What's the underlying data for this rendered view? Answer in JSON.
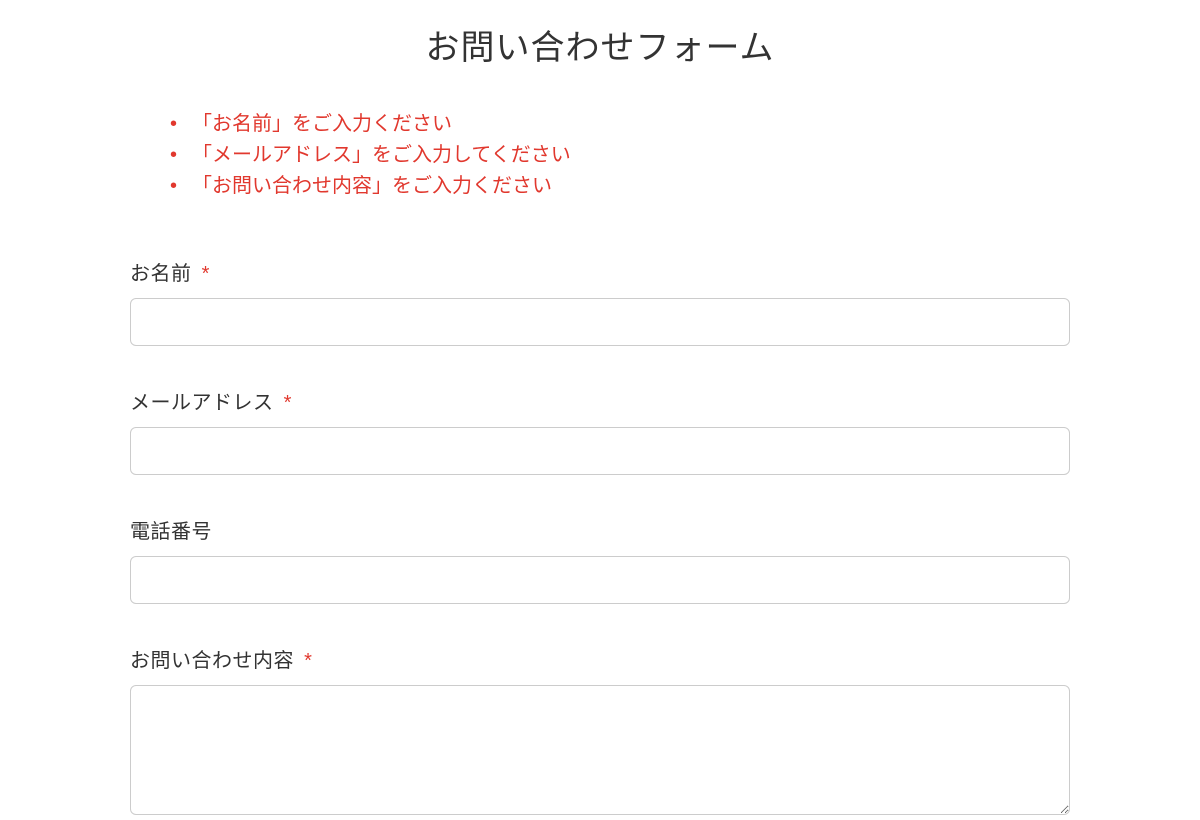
{
  "form": {
    "title": "お問い合わせフォーム",
    "required_mark": "*",
    "errors": [
      "「お名前」をご入力ください",
      "「メールアドレス」をご入力してください",
      "「お問い合わせ内容」をご入力ください"
    ],
    "fields": {
      "name": {
        "label": "お名前",
        "required": true,
        "value": ""
      },
      "email": {
        "label": "メールアドレス",
        "required": true,
        "value": ""
      },
      "phone": {
        "label": "電話番号",
        "required": false,
        "value": ""
      },
      "message": {
        "label": "お問い合わせ内容",
        "required": true,
        "value": ""
      }
    }
  }
}
